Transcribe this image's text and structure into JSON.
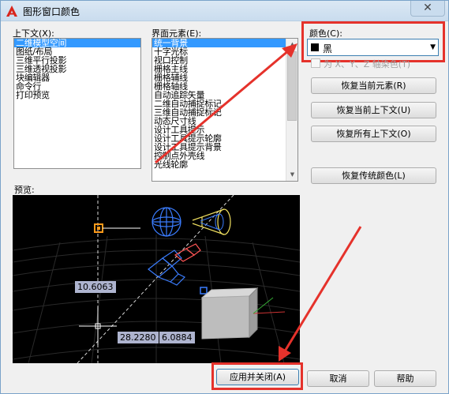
{
  "window": {
    "title": "图形窗口颜色",
    "close_glyph": "✕",
    "app_letter": "A"
  },
  "context": {
    "label": "上下文(X):",
    "items": [
      "二维模型空间",
      "图纸/布局",
      "三维平行投影",
      "三维透视投影",
      "块编辑器",
      "命令行",
      "打印预览"
    ],
    "selected_index": 0
  },
  "interface": {
    "label": "界面元素(E):",
    "items": [
      "统一背景",
      "十字光标",
      "视口控制",
      "栅格主线",
      "栅格辅线",
      "栅格轴线",
      "自动追踪矢量",
      "二维自动捕捉标记",
      "三维自动捕捉标记",
      "动态尺寸线",
      "设计工具提示",
      "设计工具提示轮廓",
      "设计工具提示背景",
      "控制点外壳线",
      "光线轮廓"
    ],
    "selected_index": 0
  },
  "color": {
    "label": "颜色(C):",
    "value": "黑",
    "swatch": "#000000"
  },
  "tint_checkbox": {
    "label": "为 X、Y、Z 轴染色(T)",
    "checked": false
  },
  "buttons": {
    "restore_current_element": "恢复当前元素(R)",
    "restore_current_context": "恢复当前上下文(U)",
    "restore_all_contexts": "恢复所有上下文(O)",
    "restore_classic_colors": "恢复传统颜色(L)",
    "apply_close": "应用并关闭(A)",
    "cancel": "取消",
    "help": "帮助"
  },
  "preview": {
    "label": "预览:",
    "dimension_1": "10.6063",
    "dimension_2": "28.2280",
    "dimension_3": "6.0884"
  },
  "colors": {
    "selection": "#3399ff",
    "annotation_red": "#e5322b",
    "preview_bg": "#000000"
  }
}
